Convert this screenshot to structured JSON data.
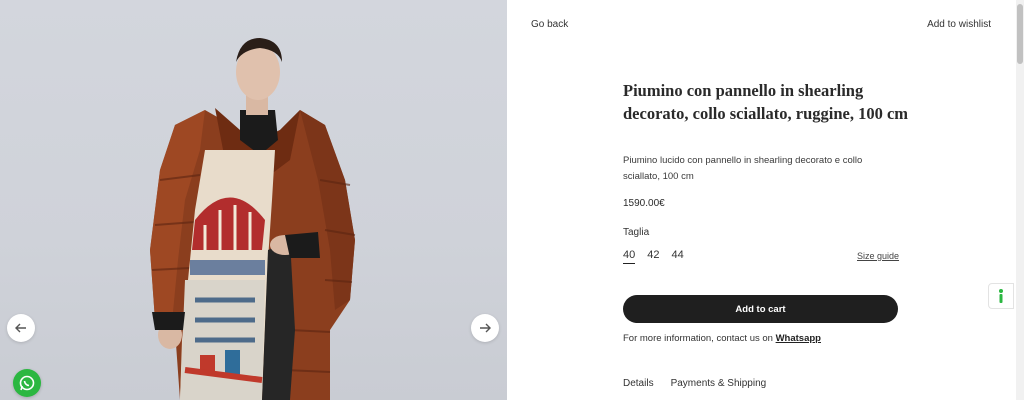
{
  "nav": {
    "go_back": "Go back",
    "wishlist": "Add to wishlist"
  },
  "product": {
    "title": "Piumino con pannello in shearling decorato, collo sciallato, ruggine, 100 cm",
    "description": "Piumino lucido con pannello in shearling decorato e collo sciallato, 100 cm",
    "price": "1590.00€",
    "size_label": "Taglia",
    "sizes": [
      "40",
      "42",
      "44"
    ],
    "selected_size": "40",
    "size_guide": "Size guide",
    "add_to_cart": "Add to cart",
    "contact_text": "For more information, contact us on ",
    "contact_link": "Whatsapp"
  },
  "tabs": [
    "Details",
    "Payments & Shipping"
  ],
  "icons": {
    "prev": "arrow-left-icon",
    "next": "arrow-right-icon",
    "whatsapp": "whatsapp-icon",
    "accessibility": "accessibility-icon"
  },
  "colors": {
    "button_bg": "#1f1f1f",
    "whatsapp": "#2bb741",
    "coat": "#8b3e1e"
  }
}
